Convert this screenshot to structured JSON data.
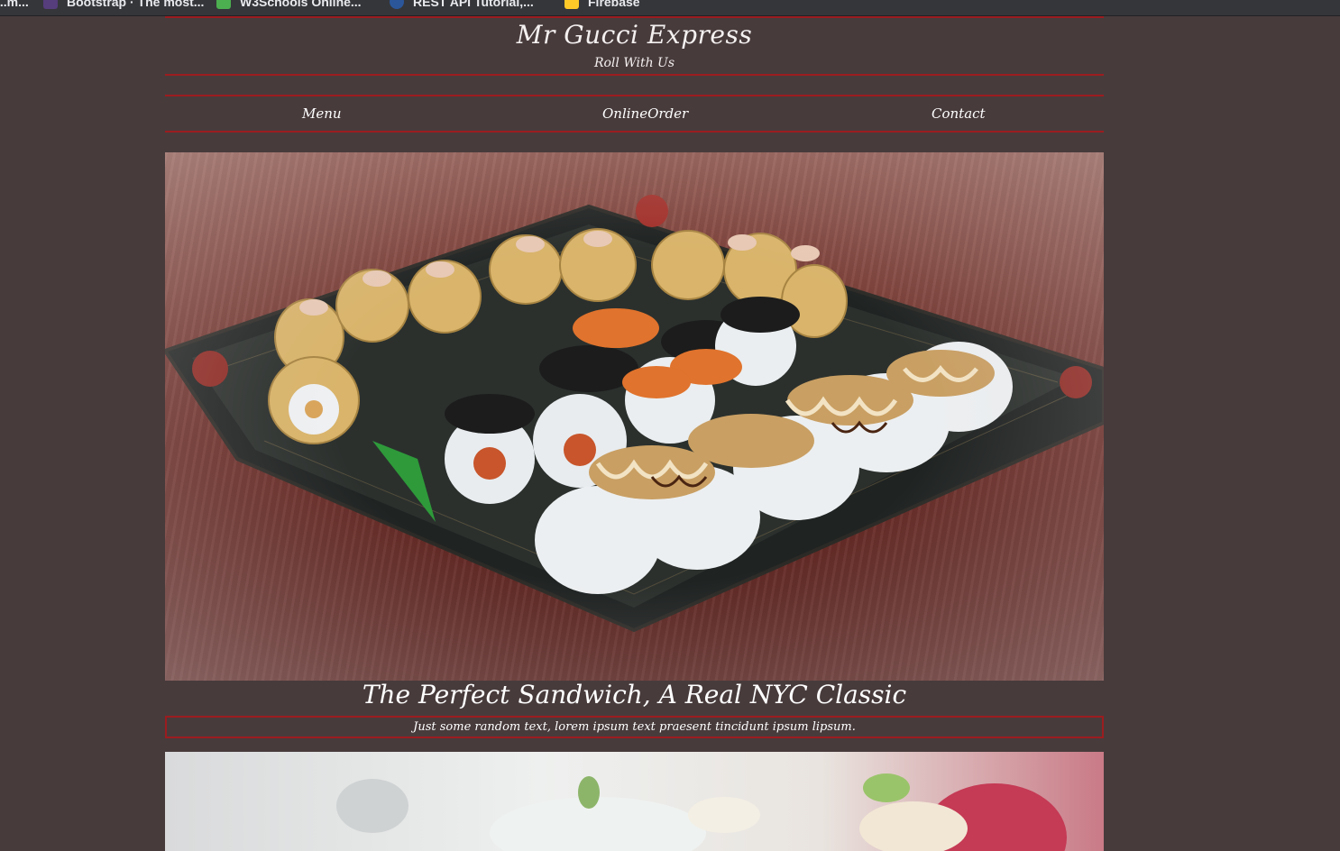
{
  "bookmarks": [
    {
      "label": "...m...",
      "icon": "apps-icon",
      "color": "#5f6368"
    },
    {
      "label": "Bootstrap · The most...",
      "icon": "bootstrap-icon",
      "color": "#563d7c"
    },
    {
      "label": "W3Schools Online...",
      "icon": "w3schools-icon",
      "color": "#4caf50"
    },
    {
      "label": "REST API Tutorial,...",
      "icon": "api-icon",
      "color": "#2b579a"
    },
    {
      "label": "Firebase",
      "icon": "firebase-icon",
      "color": "#ffca28"
    }
  ],
  "header": {
    "title": "Mr Gucci Express",
    "tagline": "Roll With Us"
  },
  "nav": {
    "items": [
      "Menu",
      "OnlineOrder",
      "Contact"
    ]
  },
  "hero": {
    "image_subject": "sushi-platter",
    "title": "The Perfect Sandwich, A Real NYC Classic",
    "caption": "Just some random text, lorem ipsum text praesent tincidunt ipsum lipsum."
  },
  "second_image": {
    "image_subject": "sushi-closeup"
  },
  "colors": {
    "background": "#483b3c",
    "accent_border": "#9b1c1f",
    "text": "#ffffff"
  }
}
